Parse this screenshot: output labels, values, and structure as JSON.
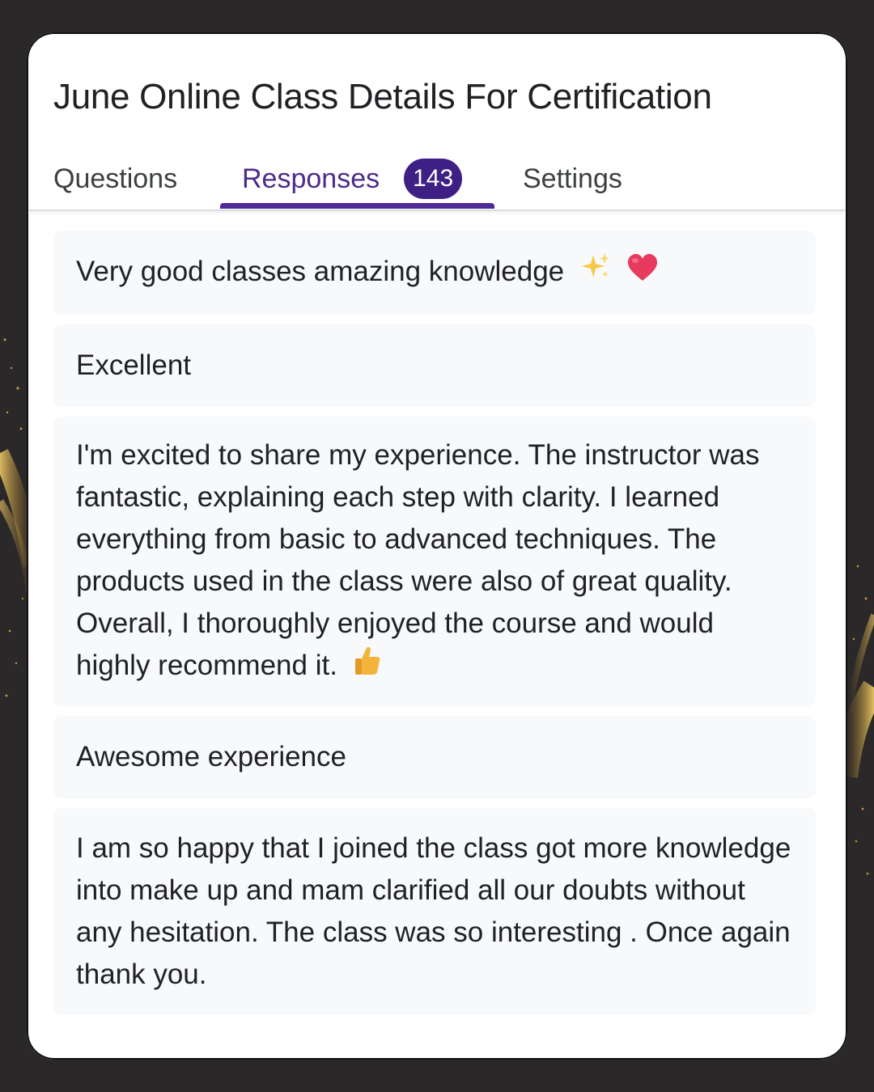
{
  "form": {
    "title": "June Online Class Details For Certification"
  },
  "tabs": {
    "questions": "Questions",
    "responses": "Responses",
    "responses_count": "143",
    "settings": "Settings"
  },
  "responses": [
    {
      "text": "Very good classes amazing knowledge",
      "emojis": [
        "sparkles-icon",
        "heart-icon"
      ]
    },
    {
      "text": "Excellent"
    },
    {
      "text": "I'm excited to share my experience. The instructor was fantastic, explaining each step with clarity. I learned everything from basic to advanced techniques. The products used in the class were also of great quality. Overall, I thoroughly enjoyed the course and would highly recommend it.",
      "emojis": [
        "thumbs-up-icon"
      ]
    },
    {
      "text": "Awesome experience"
    },
    {
      "text": "I am so happy that I joined the class got more knowledge into make up and mam clarified all our doubts without any hesitation. The class was so interesting . Once again thank you."
    }
  ],
  "colors": {
    "accent": "#4f2a96",
    "badge": "#3e1f83",
    "response_bg": "#f8f9fa",
    "page_bg": "#2b2829"
  }
}
